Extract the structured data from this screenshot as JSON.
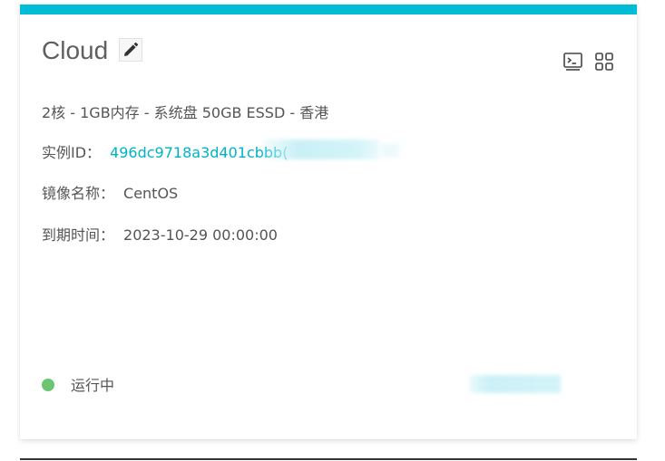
{
  "card": {
    "title": "Cloud",
    "spec": "2核 - 1GB内存 - 系统盘 50GB ESSD - 香港",
    "instance_id": {
      "label": "实例ID：",
      "value": "496dc9718a3d401cbbb("
    },
    "image_name": {
      "label": "镜像名称：",
      "value": "CentOS"
    },
    "expiry": {
      "label": "到期时间：",
      "value": "2023-10-29 00:00:00"
    },
    "status": {
      "text": "运行中",
      "color": "#6cc570"
    }
  },
  "icons": {
    "edit": "pencil-icon",
    "terminal": "terminal-icon",
    "grid": "grid-icon"
  },
  "colors": {
    "accent": "#00bcd4",
    "link": "#00b2c9"
  }
}
